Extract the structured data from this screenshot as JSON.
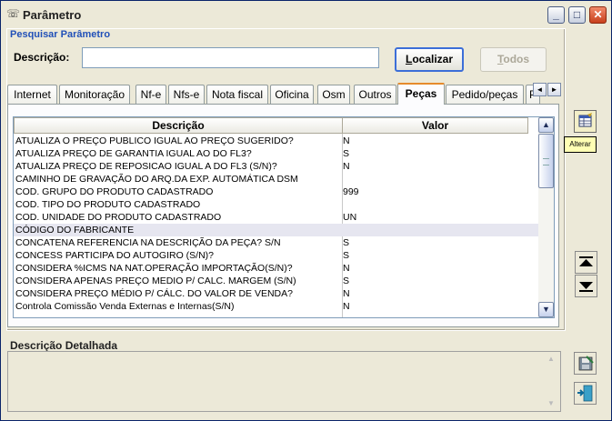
{
  "window": {
    "title": "Parâmetro",
    "icon": "phone-icon",
    "controls": {
      "minimize": "_",
      "maximize": "□",
      "close": "✕"
    }
  },
  "search": {
    "section_title": "Pesquisar Parâmetro",
    "description_label": "Descrição:",
    "description_value": "",
    "localizar_label": "Localizar",
    "todos_label": "Todos"
  },
  "tabs": [
    {
      "label": "Internet"
    },
    {
      "label": "Monitoração"
    },
    {
      "label": "Nf-e"
    },
    {
      "label": "Nfs-e"
    },
    {
      "label": "Nota fiscal"
    },
    {
      "label": "Oficina"
    },
    {
      "label": "Osm"
    },
    {
      "label": "Outros"
    },
    {
      "label": "Peças",
      "active": true
    },
    {
      "label": "Pedido/peças"
    },
    {
      "label": "P"
    }
  ],
  "grid": {
    "headers": {
      "descricao": "Descrição",
      "valor": "Valor"
    },
    "selected_row": 7,
    "rows": [
      {
        "descricao": "ATUALIZA O PREÇO PUBLICO IGUAL AO PREÇO SUGERIDO?",
        "valor": "N"
      },
      {
        "descricao": "ATUALIZA PREÇO DE GARANTIA IGUAL AO DO FL3?",
        "valor": "S"
      },
      {
        "descricao": "ATUALIZA PREÇO DE REPOSICAO IGUAL A DO FL3 (S/N)?",
        "valor": "N"
      },
      {
        "descricao": "CAMINHO DE GRAVAÇÃO DO ARQ.DA EXP. AUTOMÁTICA DSM",
        "valor": ""
      },
      {
        "descricao": "COD. GRUPO DO PRODUTO CADASTRADO",
        "valor": "999"
      },
      {
        "descricao": "COD. TIPO DO PRODUTO CADASTRADO",
        "valor": ""
      },
      {
        "descricao": "COD. UNIDADE DO PRODUTO CADASTRADO",
        "valor": "UN"
      },
      {
        "descricao": "CÓDIGO DO FABRICANTE",
        "valor": ""
      },
      {
        "descricao": "CONCATENA REFERENCIA NA DESCRIÇÃO DA PEÇA? S/N",
        "valor": "S"
      },
      {
        "descricao": "CONCESS PARTICIPA DO AUTOGIRO (S/N)?",
        "valor": "S"
      },
      {
        "descricao": "CONSIDERA %ICMS NA NAT.OPERAÇÃO IMPORTAÇÃO(S/N)?",
        "valor": "N"
      },
      {
        "descricao": "CONSIDERA APENAS PREÇO MEDIO P/ CALC. MARGEM (S/N)",
        "valor": "S"
      },
      {
        "descricao": "CONSIDERA PREÇO MÉDIO P/ CÁLC. DO VALOR DE VENDA?",
        "valor": "N"
      },
      {
        "descricao": "Controla Comissão Venda Externas e Internas(S/N)",
        "valor": "N"
      }
    ]
  },
  "detail": {
    "label": "Descrição Detalhada",
    "value": ""
  },
  "side": {
    "tooltip": "Alterar",
    "icons": [
      "edit-table-icon",
      "move-top-icon",
      "move-bottom-icon",
      "save-disk-icon",
      "exit-door-icon"
    ]
  },
  "scroll_glyphs": {
    "up": "▲",
    "down": "▼",
    "left": "◄",
    "right": "►"
  }
}
